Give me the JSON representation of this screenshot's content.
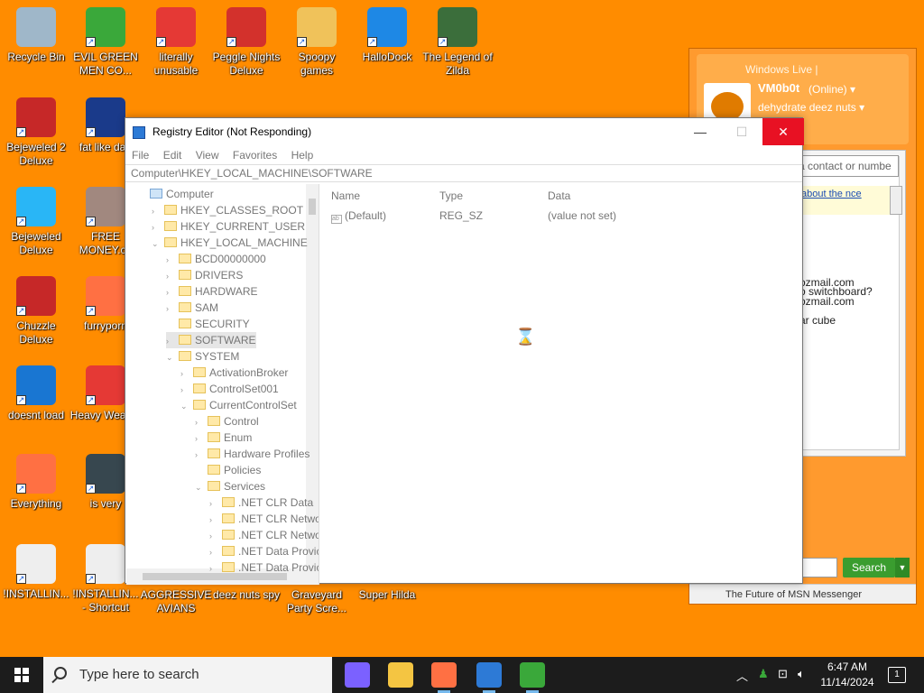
{
  "desktop": {
    "icons": [
      {
        "label": "Recycle Bin",
        "icon": "recycle-bin-icon",
        "color": "#9fb7c9"
      },
      {
        "label": "EVIL GREEN MEN CO...",
        "icon": "msn-buddies-icon",
        "color": "#3aa83a"
      },
      {
        "label": "literally unusable",
        "icon": "chrome-icon",
        "color": "#e53935"
      },
      {
        "label": "Peggle Nights Deluxe",
        "icon": "peggle-icon",
        "color": "#d3312c"
      },
      {
        "label": "Spoopy games",
        "icon": "games-folder-icon",
        "color": "#f0c25a"
      },
      {
        "label": "HalloDock",
        "icon": "windows-shield-icon",
        "color": "#1e88e5"
      },
      {
        "label": "The Legend of Zilda",
        "icon": "zilda-game-icon",
        "color": "#3b6e3b"
      },
      {
        "label": "Bejeweled 2 Deluxe",
        "icon": "bejeweled-2-icon",
        "color": "#c62828"
      },
      {
        "label": "fat like darl",
        "icon": "mpl-icon",
        "color": "#1a3a8a"
      },
      {
        "label": "Bejeweled Deluxe",
        "icon": "gem-icon",
        "color": "#29b6f6"
      },
      {
        "label": "FREE MONEY.co",
        "icon": "money-bag-icon",
        "color": "#a1887f"
      },
      {
        "label": "Chuzzle Deluxe",
        "icon": "chuzzle-icon",
        "color": "#c62828"
      },
      {
        "label": "furryporn",
        "icon": "firefox-icon",
        "color": "#ff7043"
      },
      {
        "label": "doesnt load",
        "icon": "thunderbird-icon",
        "color": "#1976d2"
      },
      {
        "label": "Heavy Weap...",
        "icon": "radiation-icon",
        "color": "#e53935"
      },
      {
        "label": "Everything",
        "icon": "magnifier-icon",
        "color": "#ff7043"
      },
      {
        "label": "is very",
        "icon": "mpl-shield-icon",
        "color": "#37474f"
      },
      {
        "label": "!INSTALLIN...",
        "icon": "text-file-icon",
        "color": "#eeeeee"
      },
      {
        "label": "!INSTALLIN... - Shortcut",
        "icon": "text-file-icon",
        "color": "#eeeeee"
      },
      {
        "label": "AGGRESSIVE AVIANS",
        "icon": "",
        "color": ""
      },
      {
        "label": "deez nuts spy",
        "icon": "",
        "color": ""
      },
      {
        "label": "Graveyard Party Scre...",
        "icon": "",
        "color": ""
      },
      {
        "label": "Super Hilda",
        "icon": "",
        "color": ""
      }
    ]
  },
  "msn": {
    "title": "Windows Live |",
    "username": "VM0b0t",
    "status": "(Online) ▾",
    "personal_message": "dehydrate deez nuts ▾",
    "search_placeholder": "a contact or numbe",
    "notice": "about the nce",
    "lines": [
      "o switchboard?",
      "ozmail.com",
      "ozmail.com",
      "ar cube"
    ],
    "search_button": "Search",
    "footer": "The Future of MSN Messenger"
  },
  "regedit": {
    "title": "Registry Editor (Not Responding)",
    "minimize": "—",
    "maximize": "☐",
    "close": "✕",
    "menu": [
      "File",
      "Edit",
      "View",
      "Favorites",
      "Help"
    ],
    "address": "Computer\\HKEY_LOCAL_MACHINE\\SOFTWARE",
    "tree": [
      {
        "label": "Computer",
        "exp": "",
        "depth": 0,
        "kind": "computer"
      },
      {
        "label": "HKEY_CLASSES_ROOT",
        "exp": "›",
        "depth": 1,
        "kind": "folder"
      },
      {
        "label": "HKEY_CURRENT_USER",
        "exp": "›",
        "depth": 1,
        "kind": "folder"
      },
      {
        "label": "HKEY_LOCAL_MACHINE",
        "exp": "⌄",
        "depth": 1,
        "kind": "folder"
      },
      {
        "label": "BCD00000000",
        "exp": "›",
        "depth": 2,
        "kind": "folder"
      },
      {
        "label": "DRIVERS",
        "exp": "›",
        "depth": 2,
        "kind": "folder"
      },
      {
        "label": "HARDWARE",
        "exp": "›",
        "depth": 2,
        "kind": "folder"
      },
      {
        "label": "SAM",
        "exp": "›",
        "depth": 2,
        "kind": "folder"
      },
      {
        "label": "SECURITY",
        "exp": "",
        "depth": 2,
        "kind": "folder"
      },
      {
        "label": "SOFTWARE",
        "exp": "›",
        "depth": 2,
        "kind": "folder",
        "selected": true
      },
      {
        "label": "SYSTEM",
        "exp": "⌄",
        "depth": 2,
        "kind": "folder"
      },
      {
        "label": "ActivationBroker",
        "exp": "›",
        "depth": 3,
        "kind": "folder"
      },
      {
        "label": "ControlSet001",
        "exp": "›",
        "depth": 3,
        "kind": "folder"
      },
      {
        "label": "CurrentControlSet",
        "exp": "⌄",
        "depth": 3,
        "kind": "folder"
      },
      {
        "label": "Control",
        "exp": "›",
        "depth": 4,
        "kind": "folder"
      },
      {
        "label": "Enum",
        "exp": "›",
        "depth": 4,
        "kind": "folder"
      },
      {
        "label": "Hardware Profiles",
        "exp": "›",
        "depth": 4,
        "kind": "folder"
      },
      {
        "label": "Policies",
        "exp": "",
        "depth": 4,
        "kind": "folder"
      },
      {
        "label": "Services",
        "exp": "⌄",
        "depth": 4,
        "kind": "folder"
      },
      {
        "label": ".NET CLR Data",
        "exp": "›",
        "depth": 5,
        "kind": "folder"
      },
      {
        "label": ".NET CLR Netwo",
        "exp": "›",
        "depth": 5,
        "kind": "folder"
      },
      {
        "label": ".NET CLR Netwo",
        "exp": "›",
        "depth": 5,
        "kind": "folder"
      },
      {
        "label": ".NET Data Provic",
        "exp": "›",
        "depth": 5,
        "kind": "folder"
      },
      {
        "label": ".NET Data Provic",
        "exp": "›",
        "depth": 5,
        "kind": "folder"
      }
    ],
    "columns": {
      "name": "Name",
      "type": "Type",
      "data": "Data"
    },
    "values": [
      {
        "name": "(Default)",
        "type": "REG_SZ",
        "data": "(value not set)"
      }
    ]
  },
  "taskbar": {
    "search_placeholder": "Type here to search",
    "time": "6:47 AM",
    "date": "11/14/2024",
    "notifications": "1",
    "apps": [
      {
        "name": "copilot-icon",
        "color": "#7b61ff"
      },
      {
        "name": "file-explorer-icon",
        "color": "#f4c542"
      },
      {
        "name": "firefox-taskbar-icon",
        "color": "#ff7043"
      },
      {
        "name": "regedit-taskbar-icon",
        "color": "#2d7ad6"
      },
      {
        "name": "msn-taskbar-icon",
        "color": "#3aa83a"
      }
    ]
  }
}
